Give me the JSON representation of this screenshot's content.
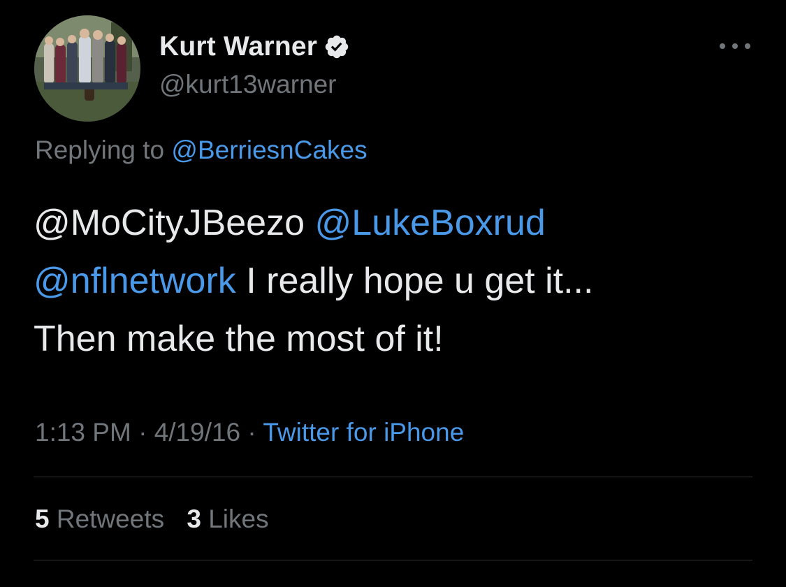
{
  "author": {
    "display_name": "Kurt Warner",
    "handle": "@kurt13warner",
    "verified": true
  },
  "reply": {
    "prefix": "Replying to",
    "to": "@BerriesnCakes"
  },
  "tweet": {
    "mention1": "@MoCityJBeezo",
    "mention2": "@LukeBoxrud",
    "mention3": "@nflnetwork",
    "text_line2": " I really hope u get it...",
    "text_line3": "Then make the most of it!"
  },
  "meta": {
    "time": "1:13 PM",
    "separator": "·",
    "date": "4/19/16",
    "source": "Twitter for iPhone"
  },
  "stats": {
    "retweets_count": "5",
    "retweets_label": "Retweets",
    "likes_count": "3",
    "likes_label": "Likes"
  },
  "icons": {
    "verified": "verified-badge-icon",
    "more": "more-horizontal-icon"
  },
  "colors": {
    "background": "#000000",
    "text": "#e7e9ea",
    "secondary": "#71767b",
    "link": "#4a99e9",
    "divider": "#2f3336"
  }
}
